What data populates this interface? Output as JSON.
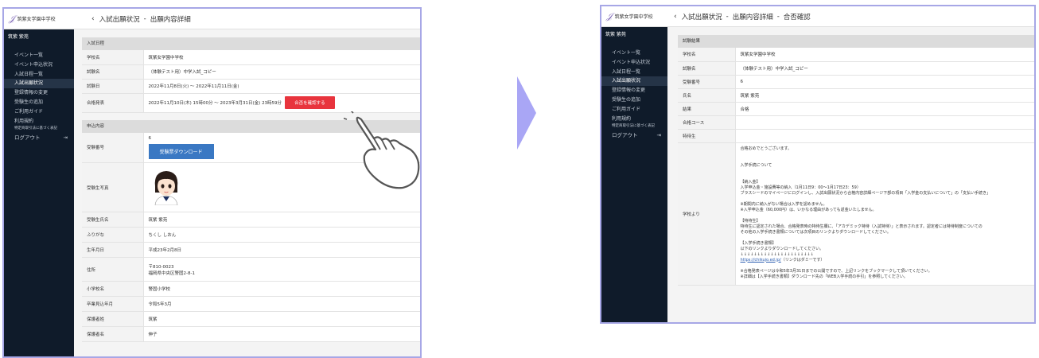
{
  "brand": {
    "school_name": "筑紫女学園中学校",
    "logo_mark": "𝒥",
    "accent": "#7b64b5",
    "sidebar_bg": "#0f1b2a"
  },
  "screen1": {
    "user_name": "筑紫 紫苑",
    "nav": [
      {
        "label": "イベント一覧"
      },
      {
        "label": "イベント申込状況"
      },
      {
        "label": "入試日程一覧"
      },
      {
        "label": "入試出願状況",
        "active": true
      },
      {
        "label": "登録情報の変更"
      },
      {
        "label": "受験生の追加"
      },
      {
        "label": "ご利用ガイド"
      },
      {
        "label": "利用規約"
      },
      {
        "label": "特定商取引法に基づく表記"
      },
      {
        "label": "ログアウト",
        "icon": "logout-icon"
      }
    ],
    "breadcrumb": {
      "back_icon": "chevron-left-icon",
      "parent": "入試出願状況",
      "sep": "-",
      "current": "出願内容詳細"
    },
    "exam_section": {
      "title": "入試日程",
      "rows": [
        {
          "label": "学校名",
          "value": "筑紫女学園中学校"
        },
        {
          "label": "試験名",
          "value": "（体験テスト用）中学入試_コピー"
        },
        {
          "label": "試験日",
          "value": "2022年11月8日(火) 〜 2022年11月11日(金)"
        },
        {
          "label": "合格発表",
          "value": "2022年11月10日(木) 15時00分 〜 2023年3月31日(金) 23時59分"
        }
      ],
      "result_button": "合否を確認する",
      "result_button_color": "#e8343d"
    },
    "app_section": {
      "title": "申込内容",
      "exam_no_label": "受験番号",
      "exam_no_value": "6",
      "download_button": "受験票ダウンロード",
      "photo_label": "受験生写真",
      "rows": [
        {
          "label": "受験生氏名",
          "value": "筑紫 紫苑"
        },
        {
          "label": "ふりがな",
          "value": "ちくし しおん"
        },
        {
          "label": "生年月日",
          "value": "平成23年2月8日"
        },
        {
          "label": "住所",
          "value": "〒810-0023",
          "value2": "福岡県中央区警固2-8-1"
        },
        {
          "label": "小学校名",
          "value": "警固小学校"
        },
        {
          "label": "卒業見込年月",
          "value": "令和5年3月"
        },
        {
          "label": "保護者姓",
          "value": "筑紫"
        },
        {
          "label": "保護者名",
          "value": "伸子"
        }
      ]
    }
  },
  "screen2": {
    "user_name": "筑紫 紫苑",
    "nav": [
      {
        "label": "イベント一覧"
      },
      {
        "label": "イベント申込状況"
      },
      {
        "label": "入試日程一覧"
      },
      {
        "label": "入試出願状況",
        "active": true
      },
      {
        "label": "登録情報の変更"
      },
      {
        "label": "受験生の追加"
      },
      {
        "label": "ご利用ガイド"
      },
      {
        "label": "利用規約"
      },
      {
        "label": "特定商取引法に基づく表記"
      },
      {
        "label": "ログアウト",
        "icon": "logout-icon"
      }
    ],
    "breadcrumb": {
      "back_icon": "chevron-left-icon",
      "parent": "入試出願状況",
      "sep1": "-",
      "middle": "出願内容詳細",
      "sep2": "-",
      "current": "合否確認"
    },
    "section_title": "試験結果",
    "rows": [
      {
        "label": "学校名",
        "value": "筑紫女学園中学校"
      },
      {
        "label": "試験名",
        "value": "（体験テスト用）中学入試_コピー"
      },
      {
        "label": "受験番号",
        "value": "6"
      },
      {
        "label": "氏名",
        "value": "筑紫 紫苑"
      },
      {
        "label": "結果",
        "value": "合格"
      },
      {
        "label": "合格コース",
        "value": ""
      },
      {
        "label": "特待生",
        "value": ""
      }
    ],
    "message_label": "学校より",
    "message": {
      "l1": "合格おめでとうございます。",
      "l2": "入学手続について",
      "l3": "【納入金】",
      "l4": "入学申込金・施設費等の納入（1月11日9：00〜1月17日23：59）",
      "l5": "ブラスシードのマイページにログインし、入試出願状況から合格内容詳細ページ下部の項目「入学金の支払いについて」の「支払い手続き」",
      "l6": "※期間内に納入がない場合は入学を認めません。",
      "l7": "※入学申込金（60,000円）は、いかなる理由があっても返金いたしません。",
      "l8": "【特待生】",
      "l9": "特待生に認定された場合、合格発表時の特待生欄に、「アカデミック特待（入試特待）」と表示されます。認定者には特待制度についての",
      "l10": "その他の入学手続き書類については次項目のリンクよりダウンロードしてください。",
      "l11": "【入学手続き書類】",
      "l12": "以下のリンクよりダウンロードしてください。",
      "l13": "↓↓↓↓↓↓↓↓↓↓↓↓↓↓↓↓↓↓↓↓↓↓",
      "l14": "https://chikujo.ed.jp/",
      "l14b": "（リンクはダミーです）",
      "l15": "※合格発表ページは令和5年3月31日までの公開ですので、上記リンクをブックマークして頂いてください。",
      "l16": "※詳細は【入学手続き書類】ダウンロード先の「WEB入学手続の手引」を参照してください。"
    }
  },
  "arrow_color": "#a9a6f5"
}
